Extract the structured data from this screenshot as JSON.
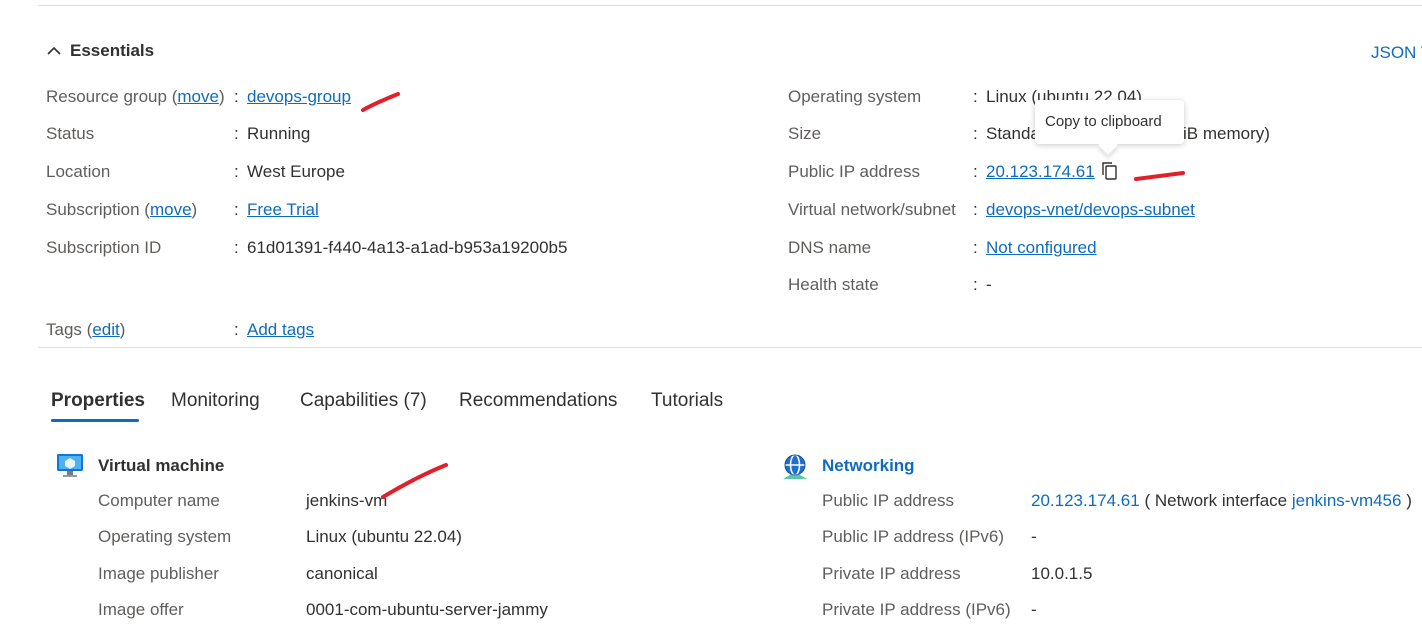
{
  "essentials": {
    "title": "Essentials",
    "json_view": "JSON V",
    "left": [
      {
        "label": "Resource group",
        "move": "move",
        "value": "devops-group"
      },
      {
        "label": "Status",
        "value": "Running"
      },
      {
        "label": "Location",
        "value": "West Europe"
      },
      {
        "label": "Subscription",
        "move": "move",
        "value": "Free Trial"
      },
      {
        "label": "Subscription ID",
        "value": "61d01391-f440-4a13-a1ad-b953a19200b5"
      }
    ],
    "right": [
      {
        "label": "Operating system",
        "value": "Linux (ubuntu 22.04)"
      },
      {
        "label": "Size",
        "value_start": "Standa",
        "value_end": "iB memory)"
      },
      {
        "label": "Public IP address",
        "value": "20.123.174.61"
      },
      {
        "label": "Virtual network/subnet",
        "value": "devops-vnet/devops-subnet"
      },
      {
        "label": "DNS name",
        "value": "Not configured"
      },
      {
        "label": "Health state",
        "value": "-"
      }
    ],
    "tags": {
      "label": "Tags",
      "edit": "edit",
      "value": "Add tags"
    },
    "colon": ":",
    "paren_open": "(",
    "paren_close": ")"
  },
  "tooltip": {
    "text": "Copy to clipboard"
  },
  "tabs": [
    {
      "label": "Properties",
      "active": true
    },
    {
      "label": "Monitoring"
    },
    {
      "label": "Capabilities (7)"
    },
    {
      "label": "Recommendations"
    },
    {
      "label": "Tutorials"
    }
  ],
  "virtual_machine": {
    "title": "Virtual machine",
    "rows": [
      {
        "label": "Computer name",
        "value": "jenkins-vm"
      },
      {
        "label": "Operating system",
        "value": "Linux (ubuntu 22.04)"
      },
      {
        "label": "Image publisher",
        "value": "canonical"
      },
      {
        "label": "Image offer",
        "value": "0001-com-ubuntu-server-jammy"
      }
    ]
  },
  "networking": {
    "title": "Networking",
    "rows": [
      {
        "label": "Public IP address",
        "value": "20.123.174.61",
        "suffix_open": "( Network interface",
        "nic": "jenkins-vm456",
        "suffix_close": ")"
      },
      {
        "label": "Public IP address (IPv6)",
        "value": "-"
      },
      {
        "label": "Private IP address",
        "value": "10.0.1.5"
      },
      {
        "label": "Private IP address (IPv6)",
        "value": "-"
      }
    ]
  },
  "colors": {
    "accent": "#0f6cbd",
    "annotation": "#e0202a"
  }
}
